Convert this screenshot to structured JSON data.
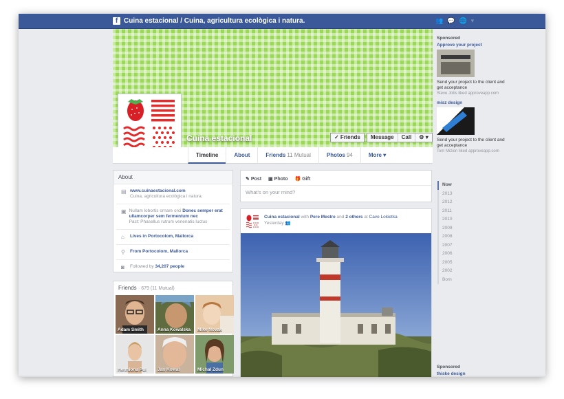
{
  "topbar": {
    "logo": "f",
    "title": "Cuina estacional / Cuina, agricultura ecològica i natura.",
    "icons": [
      "friend-requests-icon",
      "messages-icon",
      "notifications-icon",
      "settings-caret-icon"
    ]
  },
  "cover": {
    "page_name": "Cuina estacional",
    "friends_button": "✓ Friends",
    "message_button": "Message",
    "call_button": "Call",
    "settings_button": "⚙ ▾"
  },
  "tabs": [
    {
      "label": "Timeline",
      "count": ""
    },
    {
      "label": "About",
      "count": ""
    },
    {
      "label": "Friends",
      "count": "11 Mutual"
    },
    {
      "label": "Photos",
      "count": "94"
    },
    {
      "label": "More ▾",
      "count": ""
    }
  ],
  "about": {
    "heading": "About",
    "website": "www.cuinaestacional.com",
    "website_sub": "Cuina, agricultura ecològica i natura.",
    "work_line1": "Nullam lobortis ornare orci",
    "work_link": "Donec semper erat ullamcorper sem fermentum nec",
    "work_past": "Past: Phasellus rutrum venenatis luctus",
    "lives": "Lives in Portocolom, Mallorca",
    "from": "From Portocolom, Mallorca",
    "followed": "Followed by",
    "followers": "34,207 people"
  },
  "friends": {
    "heading": "Friends",
    "count": "· 679 (11 Mutual)",
    "list": [
      {
        "name": "Adam Smith"
      },
      {
        "name": "Anna Kowalska"
      },
      {
        "name": "Mike Novak"
      },
      {
        "name": "Hermiona Pui"
      },
      {
        "name": "Jan Kowal"
      },
      {
        "name": "Michał Zdun"
      }
    ]
  },
  "composer": {
    "post": "Post",
    "photo": "Photo",
    "gift": "Gift",
    "placeholder": "What's on your mind?"
  },
  "post": {
    "author": "Cuina estacional",
    "with": "with",
    "friend": "Pere Mestre",
    "and": "and",
    "others": "2 others",
    "at": "at",
    "place": "Cave Lokietka",
    "time": "Yesterday"
  },
  "ads": [
    {
      "sponsored": "Sponsored",
      "title": "Approve your project",
      "text": "Send your project to the client and get acceptance",
      "liked": "Steve Jobs liked approveapp.com"
    },
    {
      "sponsored": "",
      "title": "misz design",
      "text": "Send your project to the client and get acceptance",
      "liked": "Tom Mizion liked approveapp.com"
    },
    {
      "sponsored": "Sponsored",
      "title": "thiske design",
      "text": "",
      "liked": ""
    }
  ],
  "years": [
    "Now",
    "2013",
    "2012",
    "2011",
    "2010",
    "2009",
    "2008",
    "2007",
    "2006",
    "2005",
    "2002",
    "Born"
  ],
  "colors": {
    "brand": "#3b5998",
    "cover_green": "#9bd858",
    "accent_red": "#e32b2b"
  }
}
